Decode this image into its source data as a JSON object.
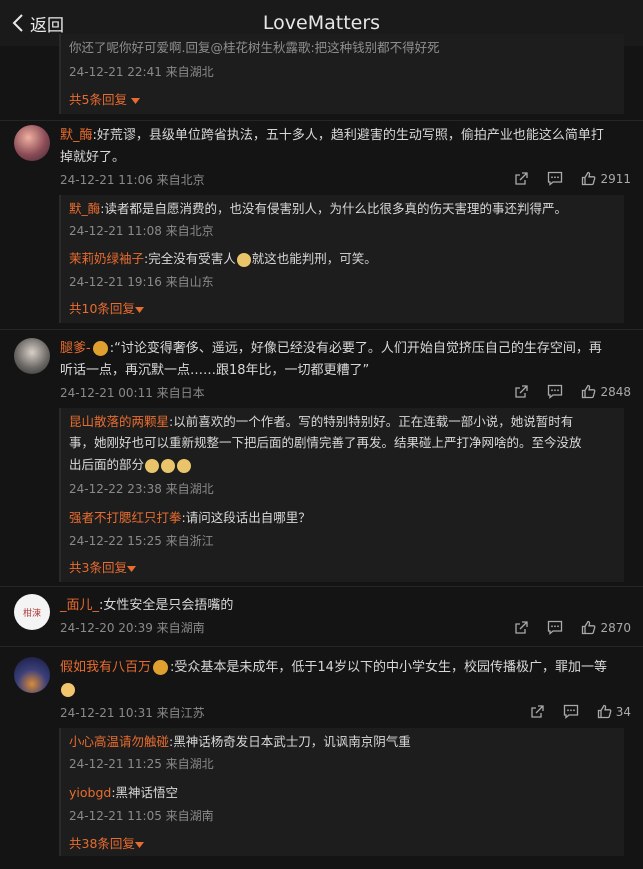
{
  "header": {
    "back_label": "返回",
    "title": "LoveMatters"
  },
  "top_thread": {
    "partial_line": "你还了呢你好可爱啊.回复@桂花树生秋露歌:把这种钱别都不得好死",
    "time": "24-12-21 22:41 来自湖北",
    "more": "共5条回复"
  },
  "comments": [
    {
      "user": "默_酶",
      "text_1": ":好荒谬，县级单位跨省执法，五十多人，趋利避害的生动写照，偷拍产业也能这么简单打",
      "text_2": "掉就好了。",
      "time": "24-12-21 11:06 来自北京",
      "likes": "2911",
      "replies": [
        {
          "user": "默_酶",
          "text": ":读者都是自愿消费的，也没有侵害别人，为什么比很多真的伤天害理的事还判得严。",
          "time": "24-12-21 11:08 来自北京"
        },
        {
          "user": "茉莉奶绿袖子",
          "text_a": ":完全没有受害人",
          "text_b": "就这也能判刑，可笑。",
          "time": "24-12-21 19:16 来自山东"
        }
      ],
      "more": "共10条回复"
    },
    {
      "user": "腿爹-",
      "text_1": ":“讨论变得奢侈、遥远，好像已经没有必要了。人们开始自觉挤压自己的生存空间，再",
      "text_2": "听话一点，再沉默一点……跟18年比，一切都更糟了”",
      "time": "24-12-21 00:11 来自日本",
      "likes": "2848",
      "replies": [
        {
          "user": "昆山散落的两颗星",
          "text_1": ":以前喜欢的一个作者。写的特别特别好。正在连载一部小说，她说暂时有",
          "text_2": "事，她刚好也可以重新规整一下把后面的剧情完善了再发。结果碰上严打净网啥的。至今没放",
          "text_3": "出后面的部分",
          "time": "24-12-22 23:38 来自湖北"
        },
        {
          "user": "强者不打腮红只打拳",
          "text": ":请问这段话出自哪里？",
          "time": "24-12-22 15:25 来自浙江"
        }
      ],
      "more": "共3条回复"
    },
    {
      "user": "_面儿_",
      "avatar_text": "柑涑",
      "text_1": ":女性安全是只会捂嘴的",
      "time": "24-12-20 20:39 来自湖南",
      "likes": "2870"
    },
    {
      "user": "假如我有八百万",
      "text_1": ":受众基本是未成年，低于14岁以下的中小学女生，校园传播极广，罪加一等",
      "time": "24-12-21 10:31 来自江苏",
      "likes": "34",
      "replies": [
        {
          "user": "小心高温请勿触碰",
          "text": ":黑神话杨奇发日本武士刀，讥讽南京阴气重",
          "time": "24-12-21 11:25 来自湖北"
        },
        {
          "user": "yiobgd",
          "text": ":黑神话悟空",
          "time": "24-12-21 11:05 来自湖南"
        }
      ],
      "more": "共38条回复"
    }
  ],
  "colors": {
    "background": "#141414",
    "username": "#e86c2f",
    "meta": "#8a8a8a"
  },
  "icons": [
    "chevron-left-icon",
    "share-icon",
    "comment-icon",
    "like-icon",
    "chevron-down-icon"
  ]
}
